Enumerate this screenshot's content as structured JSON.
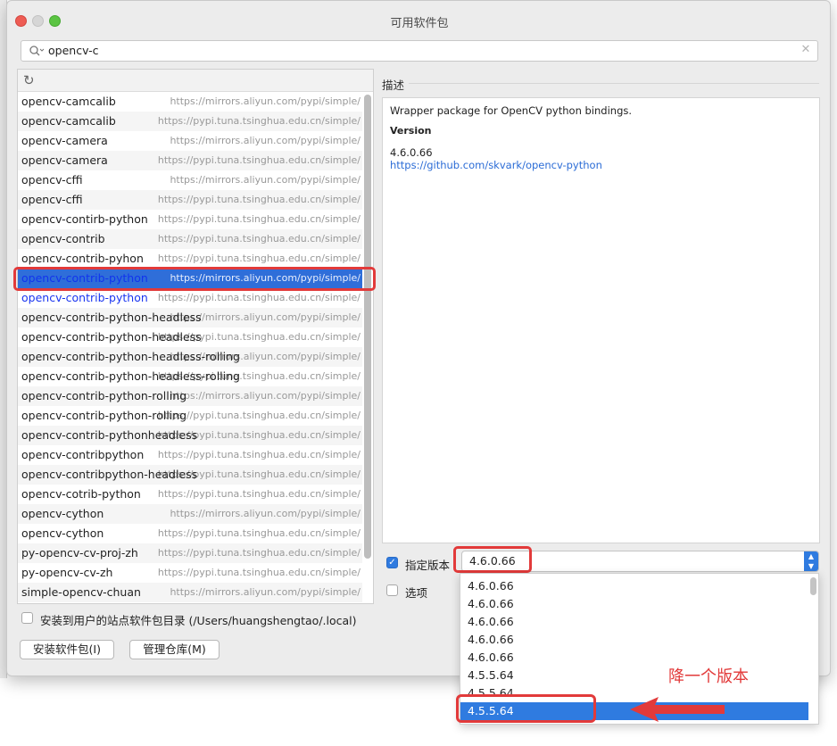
{
  "window": {
    "title": "可用软件包"
  },
  "search": {
    "value": "opencv-c"
  },
  "packages": [
    {
      "name": "opencv-camcalib",
      "repo": "https://mirrors.aliyun.com/pypi/simple/"
    },
    {
      "name": "opencv-camcalib",
      "repo": "https://pypi.tuna.tsinghua.edu.cn/simple/"
    },
    {
      "name": "opencv-camera",
      "repo": "https://mirrors.aliyun.com/pypi/simple/"
    },
    {
      "name": "opencv-camera",
      "repo": "https://pypi.tuna.tsinghua.edu.cn/simple/"
    },
    {
      "name": "opencv-cffi",
      "repo": "https://mirrors.aliyun.com/pypi/simple/"
    },
    {
      "name": "opencv-cffi",
      "repo": "https://pypi.tuna.tsinghua.edu.cn/simple/"
    },
    {
      "name": "opencv-contirb-python",
      "repo": "https://pypi.tuna.tsinghua.edu.cn/simple/"
    },
    {
      "name": "opencv-contrib",
      "repo": "https://pypi.tuna.tsinghua.edu.cn/simple/"
    },
    {
      "name": "opencv-contrib-pyhon",
      "repo": "https://pypi.tuna.tsinghua.edu.cn/simple/"
    },
    {
      "name": "opencv-contrib-python",
      "repo": "https://mirrors.aliyun.com/pypi/simple/",
      "selected": true
    },
    {
      "name": "opencv-contrib-python",
      "repo": "https://pypi.tuna.tsinghua.edu.cn/simple/",
      "highlight": true
    },
    {
      "name": "opencv-contrib-python-headless",
      "repo": "https://mirrors.aliyun.com/pypi/simple/"
    },
    {
      "name": "opencv-contrib-python-headless",
      "repo": "https://pypi.tuna.tsinghua.edu.cn/simple/"
    },
    {
      "name": "opencv-contrib-python-headless-rolling",
      "repo": "https://mirrors.aliyun.com/pypi/simple/"
    },
    {
      "name": "opencv-contrib-python-headless-rolling",
      "repo": "https://pypi.tuna.tsinghua.edu.cn/simple/"
    },
    {
      "name": "opencv-contrib-python-rolling",
      "repo": "https://mirrors.aliyun.com/pypi/simple/"
    },
    {
      "name": "opencv-contrib-python-rolling",
      "repo": "https://pypi.tuna.tsinghua.edu.cn/simple/"
    },
    {
      "name": "opencv-contrib-pythonheadless",
      "repo": "https://pypi.tuna.tsinghua.edu.cn/simple/"
    },
    {
      "name": "opencv-contribpython",
      "repo": "https://pypi.tuna.tsinghua.edu.cn/simple/"
    },
    {
      "name": "opencv-contribpython-headless",
      "repo": "https://pypi.tuna.tsinghua.edu.cn/simple/"
    },
    {
      "name": "opencv-cotrib-python",
      "repo": "https://pypi.tuna.tsinghua.edu.cn/simple/"
    },
    {
      "name": "opencv-cython",
      "repo": "https://mirrors.aliyun.com/pypi/simple/"
    },
    {
      "name": "opencv-cython",
      "repo": "https://pypi.tuna.tsinghua.edu.cn/simple/"
    },
    {
      "name": "py-opencv-cv-proj-zh",
      "repo": "https://pypi.tuna.tsinghua.edu.cn/simple/"
    },
    {
      "name": "py-opencv-cv-zh",
      "repo": "https://pypi.tuna.tsinghua.edu.cn/simple/"
    },
    {
      "name": "simple-opencv-chuan",
      "repo": "https://mirrors.aliyun.com/pypi/simple/"
    }
  ],
  "description": {
    "label": "描述",
    "text": "Wrapper package for OpenCV python bindings.",
    "version_heading": "Version",
    "version": "4.6.0.66",
    "link": "https://github.com/skvark/opencv-python"
  },
  "options": {
    "specify_version_label": "指定版本",
    "specify_version_checked": true,
    "selected_version": "4.6.0.66",
    "options_label": "选项",
    "options_checked": false,
    "user_site_label": "安装到用户的站点软件包目录 (/Users/huangshengtao/.local)",
    "user_site_checked": false
  },
  "buttons": {
    "install": "安装软件包(I)",
    "manage": "管理仓库(M)"
  },
  "version_dropdown": {
    "items": [
      "4.6.0.66",
      "4.6.0.66",
      "4.6.0.66",
      "4.6.0.66",
      "4.6.0.66",
      "4.5.5.64",
      "4.5.5.64",
      "4.5.5.64"
    ],
    "highlighted_index": 7
  },
  "annotation": {
    "text": "降一个版本",
    "color": "#e23a3a"
  },
  "colors": {
    "selection": "#2f6ed9",
    "accent": "#2f7be0",
    "annotation": "#e23a3a"
  }
}
